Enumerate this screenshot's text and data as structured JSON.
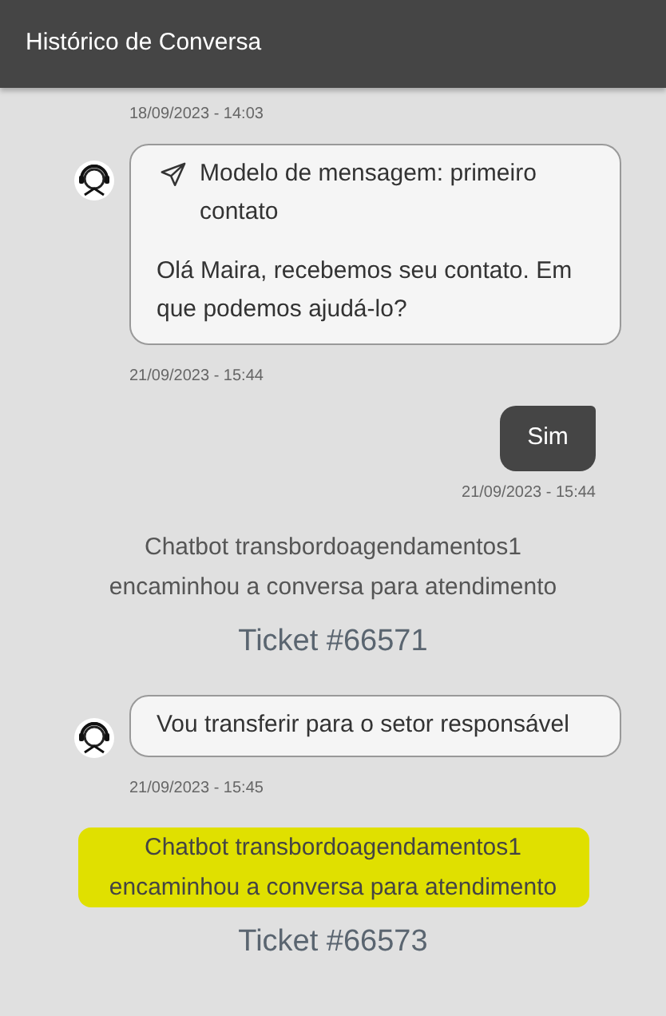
{
  "header": {
    "title": "Histórico de Conversa"
  },
  "messages": [
    {
      "kind": "bot_cut",
      "time": "18/09/2023 - 14:03"
    },
    {
      "kind": "bot_template",
      "template_title": "Modelo de mensagem: primeiro contato",
      "text": "Olá Maira, recebemos seu contato. Em que podemos ajudá-lo?",
      "time": "21/09/2023 - 15:44"
    },
    {
      "kind": "user",
      "text": "Sim",
      "time": "21/09/2023 - 15:44"
    },
    {
      "kind": "event",
      "text": "Chatbot transbordoagendamentos1 encaminhou a conversa para atendimento",
      "ticket": "Ticket #66571",
      "highlighted": false
    },
    {
      "kind": "bot",
      "text": "Vou transferir para o setor responsável",
      "time": "21/09/2023 - 15:45"
    },
    {
      "kind": "event",
      "text": "Chatbot transbordoagendamentos1 encaminhou a conversa para atendimento",
      "ticket": "Ticket #66573",
      "highlighted": true
    }
  ]
}
